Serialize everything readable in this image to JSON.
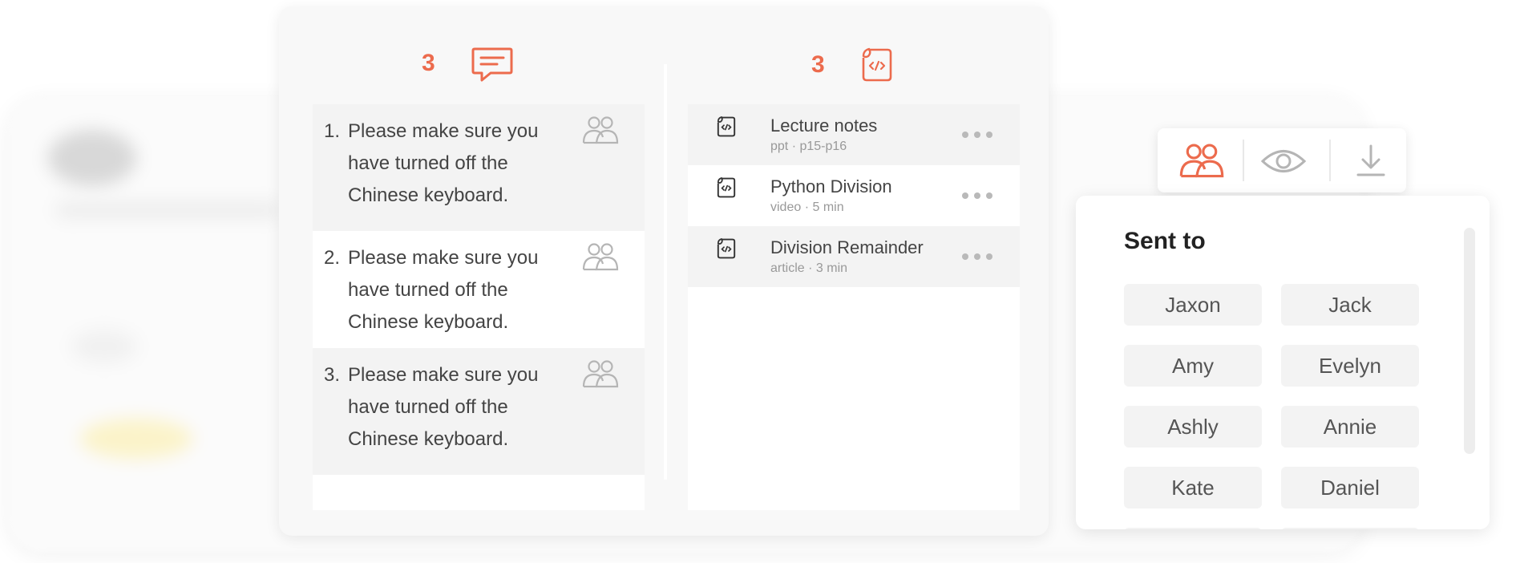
{
  "colors": {
    "accent": "#ec6b4d",
    "muted_icon": "#b5b5b5"
  },
  "comments": {
    "count": "3",
    "icon": "chat-bubble-icon",
    "items": [
      {
        "number": "1.",
        "text": "Please make sure you have turned off the Chinese keyboard.",
        "icon": "group-icon"
      },
      {
        "number": "2.",
        "text": "Please make sure you have turned off the Chinese keyboard.",
        "icon": "group-icon"
      },
      {
        "number": "3.",
        "text": "Please make sure you have turned off the Chinese keyboard.",
        "icon": "group-icon"
      }
    ]
  },
  "resources": {
    "count": "3",
    "icon": "code-file-icon",
    "items": [
      {
        "title": "Lecture notes",
        "meta": "ppt · p15-p16",
        "icon": "code-file-icon"
      },
      {
        "title": "Python Division",
        "meta": "video · 5 min",
        "icon": "code-file-icon"
      },
      {
        "title": "Division Remainder",
        "meta": "article · 3 min",
        "icon": "code-file-icon"
      }
    ]
  },
  "toolbar": {
    "buttons": [
      {
        "icon": "group-icon",
        "active": true
      },
      {
        "icon": "eye-icon",
        "active": false
      },
      {
        "icon": "download-icon",
        "active": false
      }
    ]
  },
  "sent_to": {
    "title": "Sent to",
    "recipients": [
      "Jaxon",
      "Jack",
      "Amy",
      "Evelyn",
      "Ashly",
      "Annie",
      "Kate",
      "Daniel"
    ]
  }
}
